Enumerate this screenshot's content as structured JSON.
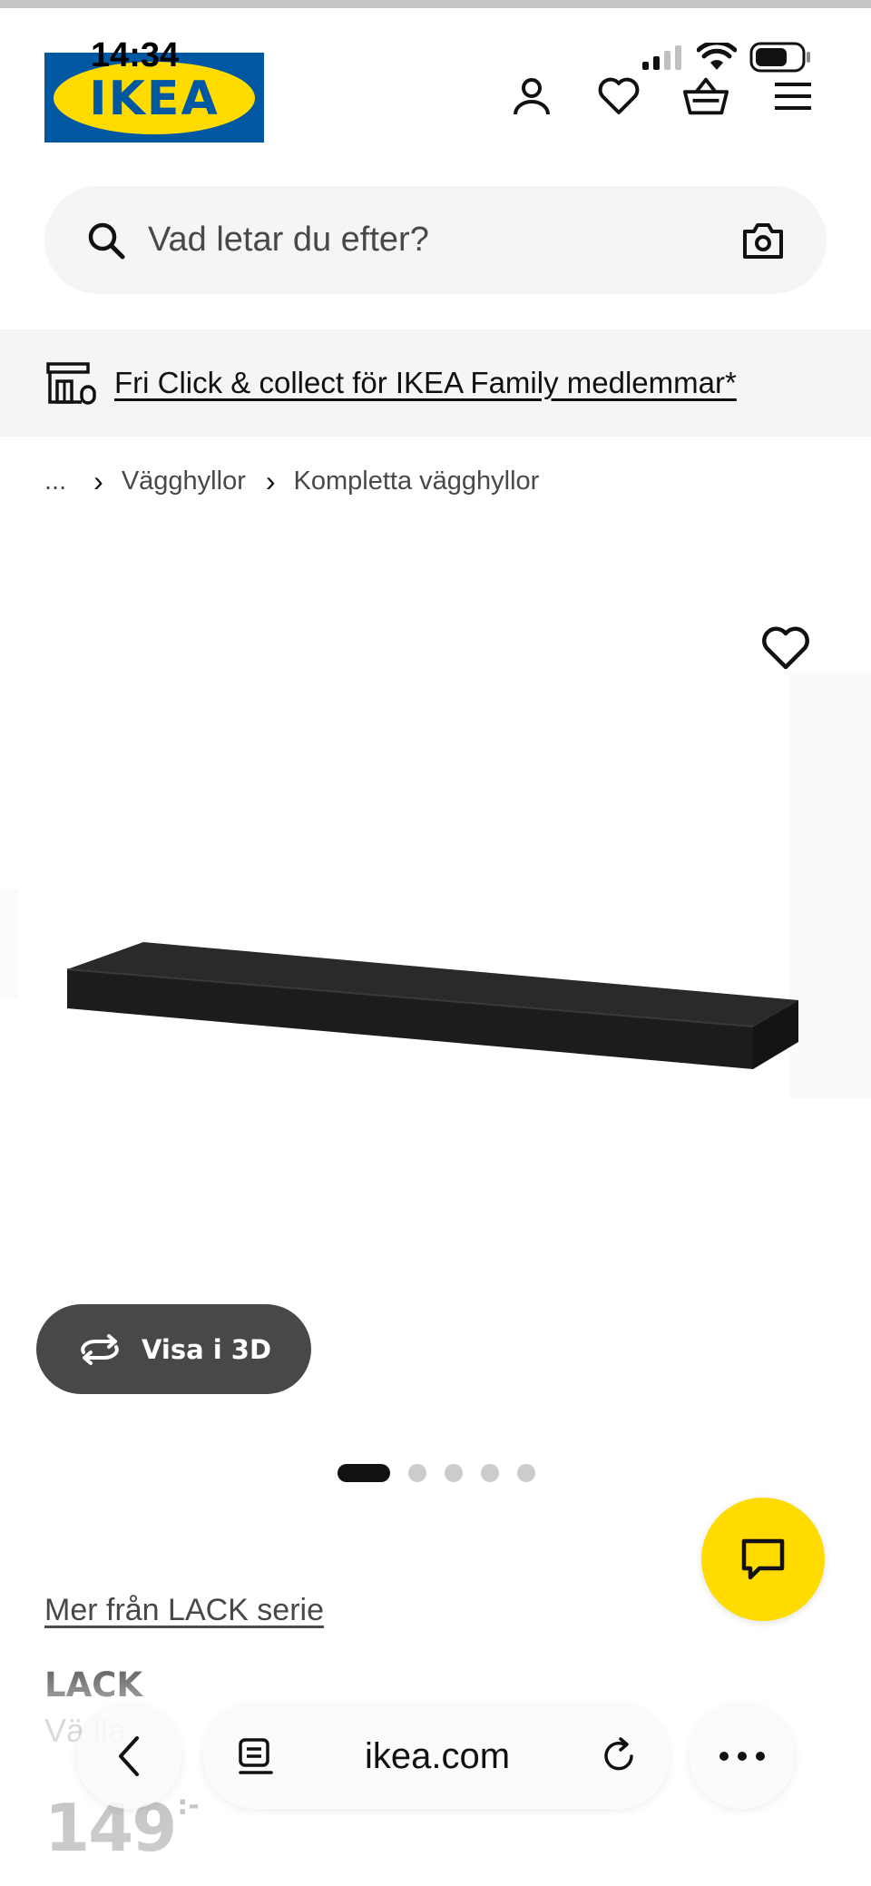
{
  "status_bar": {
    "time": "14:34"
  },
  "header": {
    "logo_text": "IKEA",
    "brand_colors": {
      "blue": "#0058a3",
      "yellow": "#ffdb00"
    },
    "icons": [
      "account-icon",
      "heart-icon",
      "basket-icon",
      "menu-icon"
    ]
  },
  "search": {
    "placeholder": "Vad letar du efter?",
    "value": ""
  },
  "promo": {
    "text": "Fri Click & collect för IKEA Family medlemmar*"
  },
  "breadcrumb": {
    "ellipsis": "...",
    "items": [
      "Vägghyllor",
      "Kompletta vägghyllor"
    ]
  },
  "gallery": {
    "view3d_label": "Visa i 3D",
    "dot_count": 5,
    "active_dot": 1
  },
  "product": {
    "series_link": "Mer från LACK serie",
    "name": "LACK",
    "description": "Vä   lla",
    "price": "149",
    "price_suffix": ":-"
  },
  "browser": {
    "url": "ikea.com"
  }
}
